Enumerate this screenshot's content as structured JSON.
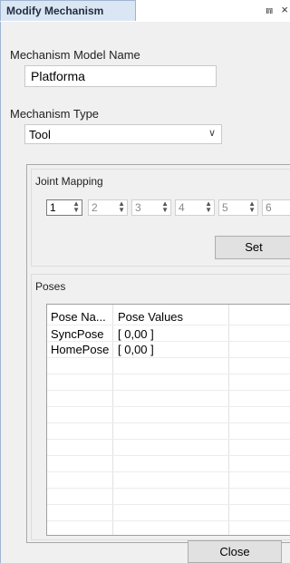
{
  "tab": {
    "title": "Modify Mechanism",
    "pin_glyph": "⩎",
    "close_glyph": "×"
  },
  "model_name": {
    "label": "Mechanism Model Name",
    "value": "Platforma"
  },
  "mechanism_type": {
    "label": "Mechanism Type",
    "value": "Tool"
  },
  "joint_mapping": {
    "label": "Joint Mapping",
    "joints": [
      "1",
      "2",
      "3",
      "4",
      "5",
      "6"
    ],
    "set_label": "Set"
  },
  "poses": {
    "label": "Poses",
    "columns": [
      "Pose Na...",
      "Pose Values"
    ],
    "rows": [
      {
        "name": "SyncPose",
        "values": "[ 0,00 ]"
      },
      {
        "name": "HomePose",
        "values": "[ 0,00 ]"
      }
    ]
  },
  "close_label": "Close"
}
